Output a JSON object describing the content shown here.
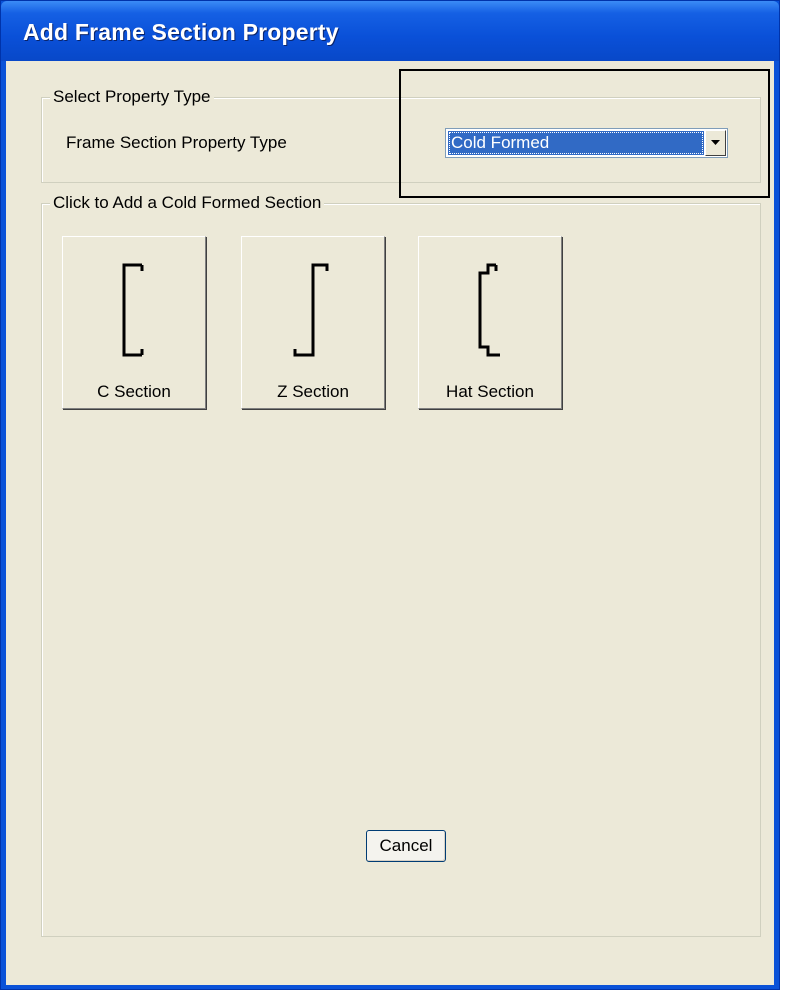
{
  "window": {
    "title": "Add Frame Section Property"
  },
  "property_type_group": {
    "legend": "Select Property Type",
    "field_label": "Frame Section Property Type",
    "selected_value": "Cold Formed"
  },
  "sections_group": {
    "legend": "Click to Add a Cold Formed Section",
    "buttons": [
      {
        "label": "C Section",
        "icon": "c-section-icon"
      },
      {
        "label": "Z Section",
        "icon": "z-section-icon"
      },
      {
        "label": "Hat Section",
        "icon": "hat-section-icon"
      }
    ]
  },
  "footer": {
    "cancel_label": "Cancel"
  },
  "colors": {
    "title_bar": "#0a52d8",
    "dialog_face": "#ece9d8",
    "selection": "#316ac5"
  }
}
